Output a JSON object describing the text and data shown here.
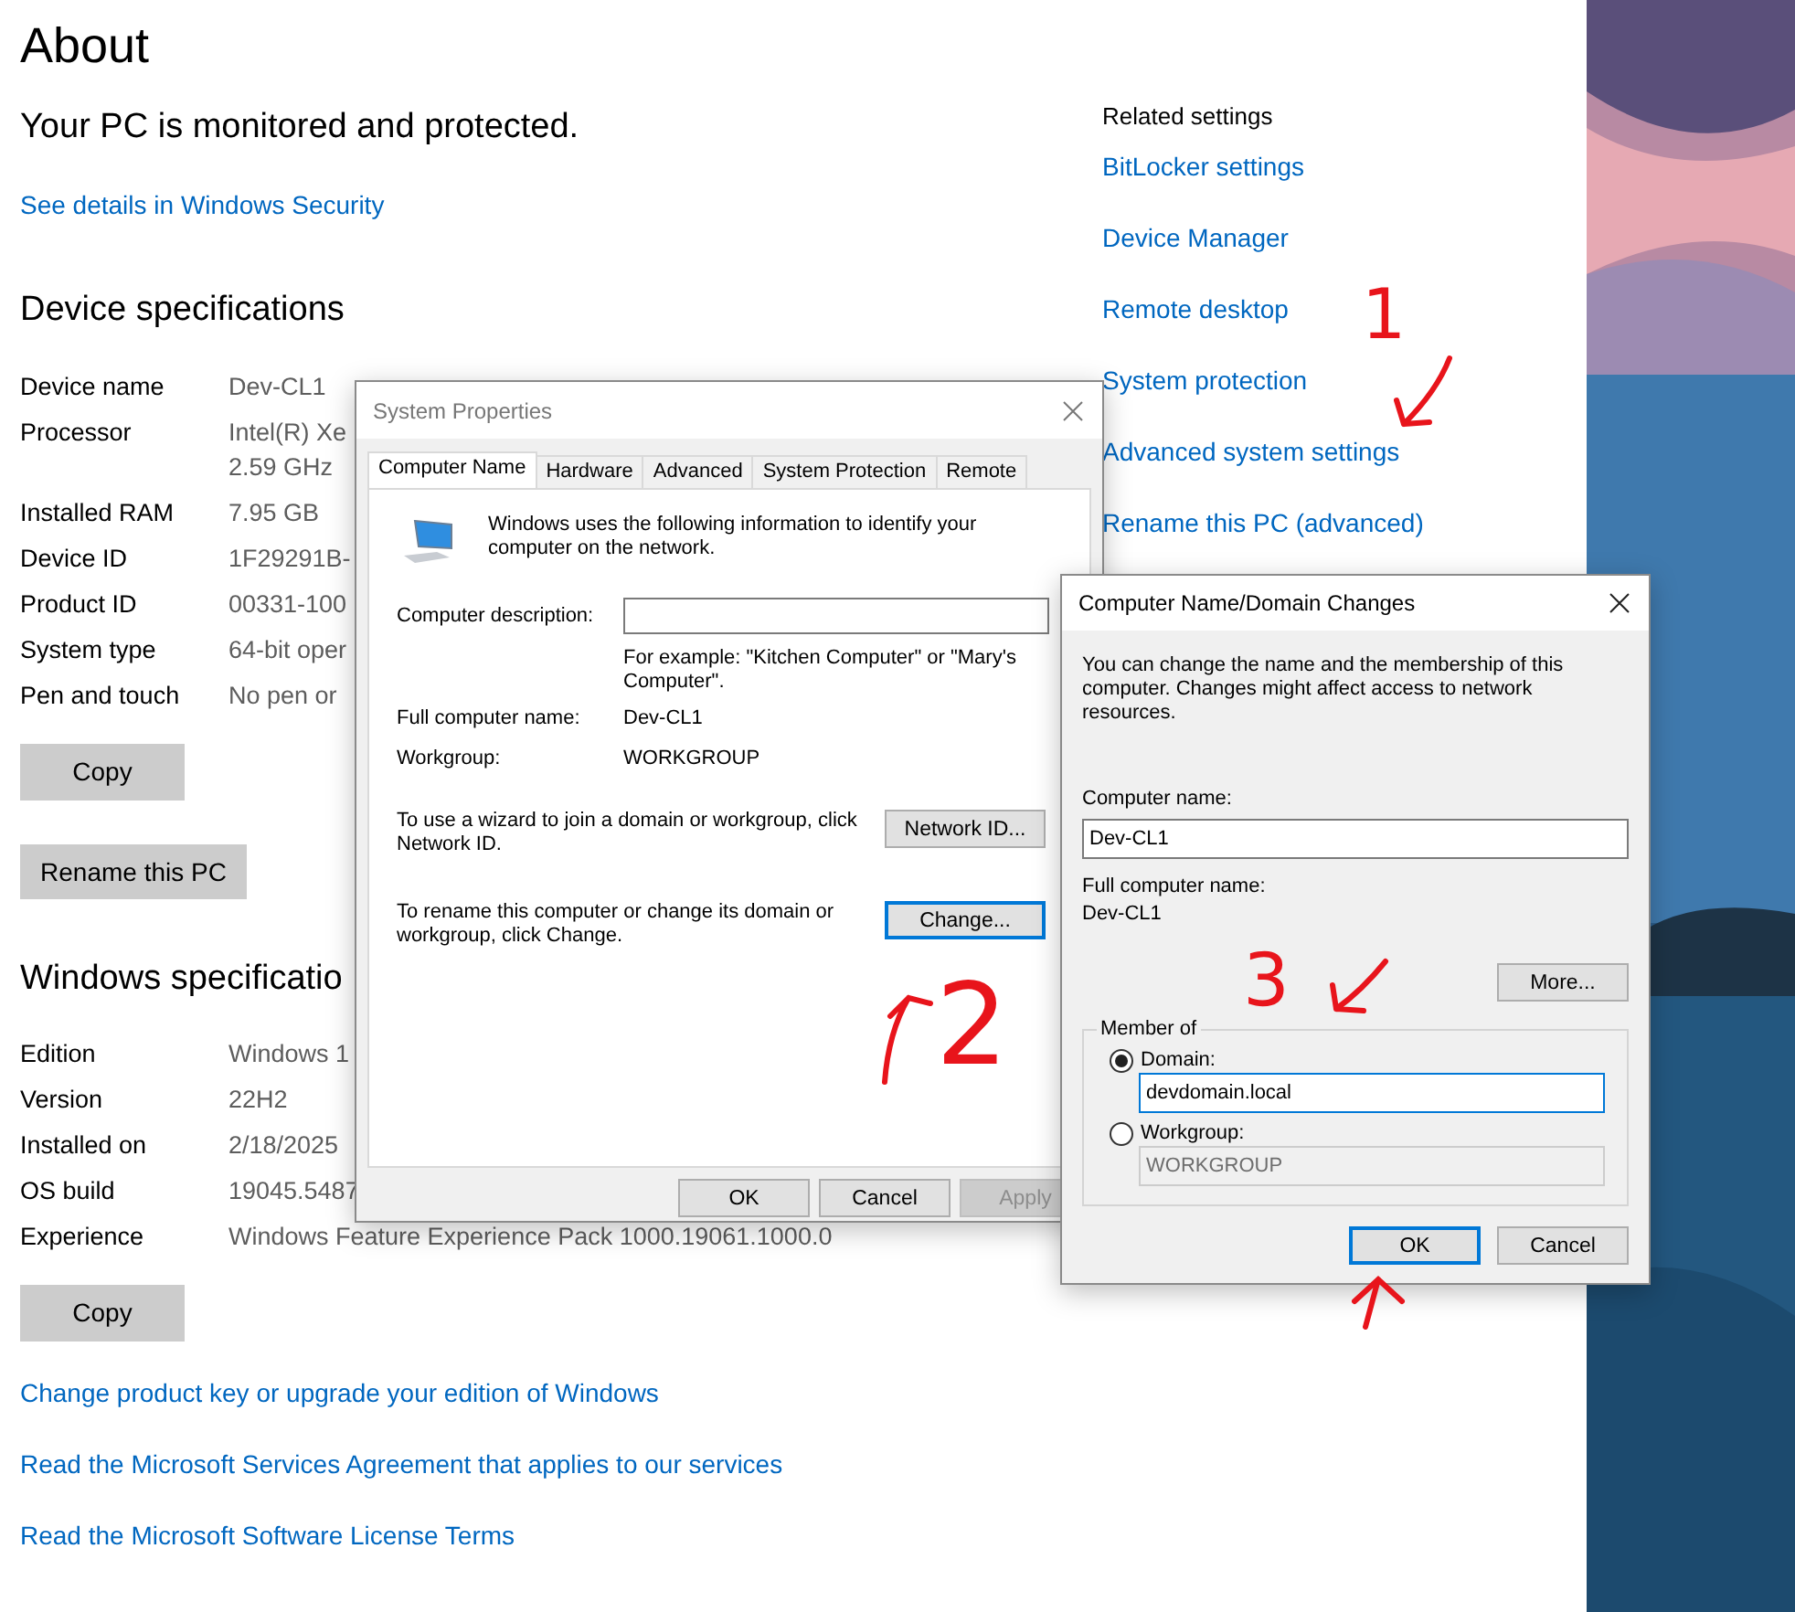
{
  "page": {
    "title": "About"
  },
  "security": {
    "status": "Your PC is monitored and protected.",
    "link": "See details in Windows Security"
  },
  "device_specs": {
    "heading": "Device specifications",
    "rows": [
      {
        "label": "Device name",
        "value": "Dev-CL1"
      },
      {
        "label": "Processor",
        "value": "Intel(R) Xe",
        "second_line": "2.59 GHz"
      },
      {
        "label": "Installed RAM",
        "value": "7.95 GB"
      },
      {
        "label": "Device ID",
        "value": "1F29291B-"
      },
      {
        "label": "Product ID",
        "value": "00331-100"
      },
      {
        "label": "System type",
        "value": "64-bit oper"
      },
      {
        "label": "Pen and touch",
        "value": "No pen or"
      }
    ],
    "copy_button": "Copy",
    "rename_button": "Rename this PC"
  },
  "windows_specs": {
    "heading": "Windows specificatio",
    "rows": [
      {
        "label": "Edition",
        "value": "Windows 1"
      },
      {
        "label": "Version",
        "value": "22H2"
      },
      {
        "label": "Installed on",
        "value": "2/18/2025"
      },
      {
        "label": "OS build",
        "value": "19045.5487"
      },
      {
        "label": "Experience",
        "value": "Windows Feature Experience Pack 1000.19061.1000.0"
      }
    ],
    "copy_button": "Copy"
  },
  "links": [
    "Change product key or upgrade your edition of Windows",
    "Read the Microsoft Services Agreement that applies to our services",
    "Read the Microsoft Software License Terms"
  ],
  "related_settings": {
    "heading": "Related settings",
    "links": [
      "BitLocker settings",
      "Device Manager",
      "Remote desktop",
      "System protection",
      "Advanced system settings",
      "Rename this PC (advanced)"
    ]
  },
  "system_properties": {
    "title": "System Properties",
    "tabs": [
      {
        "label": "Computer Name",
        "selected": true
      },
      {
        "label": "Hardware",
        "selected": false
      },
      {
        "label": "Advanced",
        "selected": false
      },
      {
        "label": "System Protection",
        "selected": false
      },
      {
        "label": "Remote",
        "selected": false
      }
    ],
    "intro": "Windows uses the following information to identify your computer on the network.",
    "description_label": "Computer description:",
    "description_hint": "For example: \"Kitchen Computer\" or \"Mary's Computer\".",
    "full_name_label": "Full computer name:",
    "full_name": "Dev-CL1",
    "workgroup_label": "Workgroup:",
    "workgroup": "WORKGROUP",
    "network_id_text": "To use a wizard to join a domain or workgroup, click Network ID.",
    "network_id_button": {
      "label": "Network ID...",
      "focused": false
    },
    "change_text": "To rename this computer or change its domain or workgroup, click Change.",
    "change_button": {
      "label": "Change...",
      "focused": true
    },
    "buttons": [
      {
        "label": "OK",
        "disabled": false
      },
      {
        "label": "Cancel",
        "disabled": false
      },
      {
        "label": "Apply",
        "disabled": true
      }
    ]
  },
  "domain_changes": {
    "title": "Computer Name/Domain Changes",
    "intro": "You can change the name and the membership of this computer. Changes might affect access to network resources.",
    "name_label": "Computer name:",
    "name_value": "Dev-CL1",
    "full_name_label": "Full computer name:",
    "full_name": "Dev-CL1",
    "more_button": "More...",
    "member_of": {
      "legend": "Member of",
      "options": [
        {
          "label": "Domain:",
          "selected": true,
          "value": "devdomain.local"
        },
        {
          "label": "Workgroup:",
          "selected": false,
          "value": "WORKGROUP"
        }
      ]
    },
    "buttons": [
      {
        "label": "OK",
        "focused": true
      },
      {
        "label": "Cancel",
        "focused": false
      }
    ]
  },
  "annotations": [
    {
      "label": "1"
    },
    {
      "label": "2"
    },
    {
      "label": "3"
    }
  ]
}
